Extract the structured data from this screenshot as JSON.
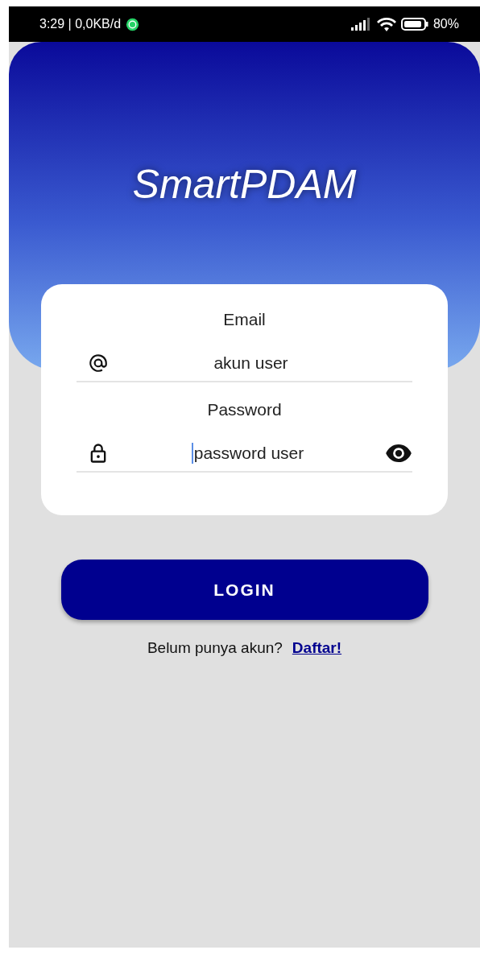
{
  "status_bar": {
    "time": "3:29 | 0,0KB/d",
    "battery": "80%"
  },
  "app_title": "SmartPDAM",
  "form": {
    "fields": [
      {
        "kind": "email",
        "label": "Email",
        "value": "akun user",
        "focused": false
      },
      {
        "kind": "password",
        "label": "Password",
        "value": "password user",
        "focused": true
      }
    ]
  },
  "login_button": "LOGIN",
  "footer": {
    "prompt": "Belum punya akun?",
    "link": "Daftar!"
  }
}
